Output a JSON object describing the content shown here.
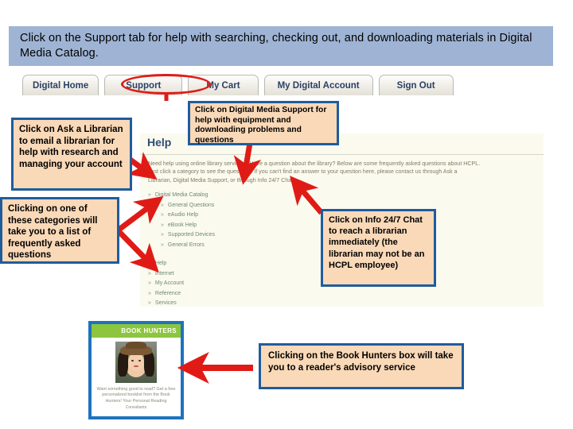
{
  "banner": {
    "text": "Click on the Support tab for help with searching, checking out, and downloading materials in Digital Media Catalog."
  },
  "nav": {
    "tabs": [
      {
        "label": "Digital Home",
        "highlighted": false
      },
      {
        "label": "Support",
        "highlighted": true
      },
      {
        "label": "My Cart",
        "highlighted": false
      },
      {
        "label": "My Digital Account",
        "highlighted": false
      },
      {
        "label": "Sign Out",
        "highlighted": false
      }
    ],
    "highlight_shape": "red-ellipse"
  },
  "help_panel": {
    "title": "Help",
    "paragraph": "Need help using online library services? Have a question about the library? Below are some frequently asked questions about HCPL. Just click a category to see the questions. If you can't find an answer to your question here, please contact us through Ask a Librarian, Digital Media Support, or through Info 24/7 Chat.",
    "categories": [
      {
        "label": "Digital Media Catalog",
        "indent": false
      },
      {
        "label": "General Questions",
        "indent": true
      },
      {
        "label": "eAudio Help",
        "indent": true
      },
      {
        "label": "eBook Help",
        "indent": true
      },
      {
        "label": "Supported Devices",
        "indent": true
      },
      {
        "label": "General Errors",
        "indent": true
      }
    ],
    "categories_lower": [
      {
        "label": "Help"
      },
      {
        "label": "Internet"
      },
      {
        "label": "My Account"
      },
      {
        "label": "Reference"
      },
      {
        "label": "Services"
      }
    ],
    "bullet": "»"
  },
  "book_hunters": {
    "title": "BOOK HUNTERS",
    "caption": "Want something good to read? Get a free personalized booklist from the Book Hunters! Your Personal Reading",
    "caption_last": "Consultants"
  },
  "callouts": {
    "ask_librarian": "Click on Ask a Librarian to email a librarian for help with research and managing your account",
    "categories": "Clicking on one of these categories will take you to a list of frequently asked questions",
    "digital_media_support": "Click on Digital Media Support for help with equipment and downloading problems and questions",
    "info_chat": "Click on Info 24/7 Chat to reach a librarian immediately (the librarian may not be an HCPL employee)",
    "book_hunters": "Clicking on the Book Hunters box will take you to a reader's advisory service"
  },
  "colors": {
    "banner_bg": "#9fb4d4",
    "callout_fill": "#fad9b8",
    "callout_border": "#1f5c9e",
    "arrow_red": "#e01b16",
    "panel_bg": "#fbfaef",
    "bh_header_green": "#8cc63e",
    "bh_border_blue": "#1f73bd",
    "tab_text": "#2b3f66"
  }
}
